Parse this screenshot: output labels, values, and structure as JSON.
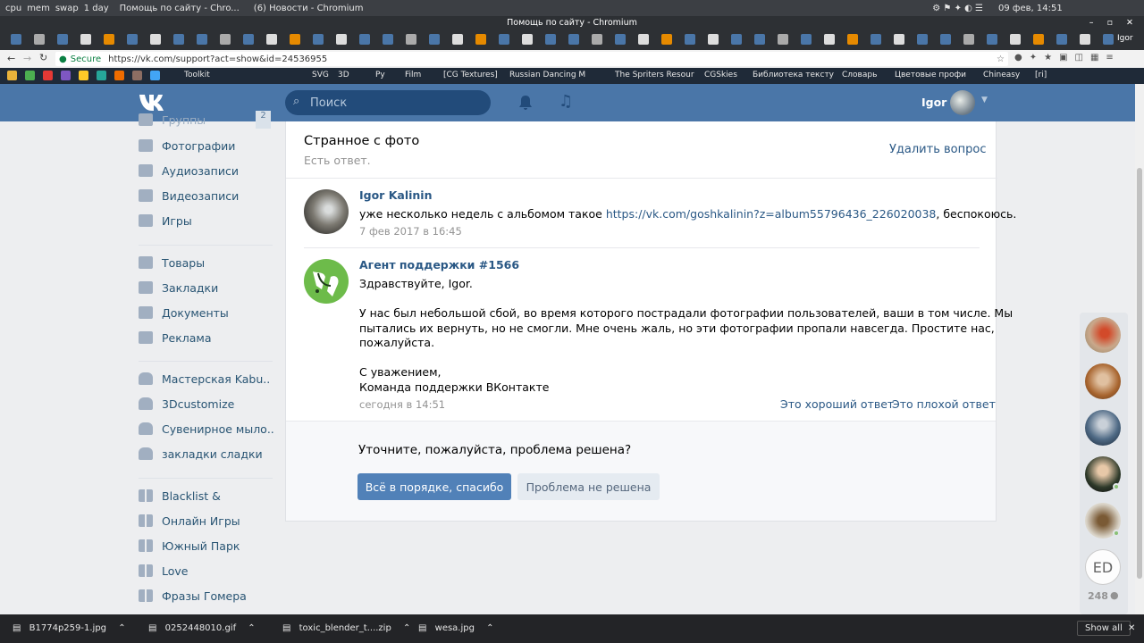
{
  "system": {
    "items": [
      "cpu",
      "mem",
      "swap",
      "1 day"
    ],
    "tab1": "Помощь по сайту - Chro...",
    "tab2": "(6) Новости - Chromium",
    "window_title": "Помощь по сайту - Chromium",
    "datetime": "09 фев, 14:51",
    "profile": "Igor"
  },
  "browser": {
    "secure": "Secure",
    "url": "https://vk.com/support?act=show&id=24536955"
  },
  "bookmarks": [
    "Toolkit",
    "SVG",
    "3D",
    "Py",
    "Film",
    "[CG Textures]",
    "Russian Dancing M",
    "The Spriters Resour",
    "CGSkies",
    "Библиотека тексту",
    "Словарь",
    "Цветовые профи",
    "Chineasy",
    "[ri]"
  ],
  "header": {
    "search_placeholder": "Поиск",
    "user_name": "Igor"
  },
  "sidebar": {
    "groups_label": "Группы",
    "groups_count": "2",
    "items": [
      "Фотографии",
      "Аудиозаписи",
      "Видеозаписи",
      "Игры",
      "Товары",
      "Закладки",
      "Документы",
      "Реклама",
      "Мастерская Kabu..",
      "3Dcustomize",
      "Сувенирное мыло..",
      "закладки сладки",
      "Blacklist &",
      "Онлайн Игры",
      "Южный Парк",
      "Love",
      "Фразы Гомера"
    ]
  },
  "question": {
    "title": "Странное с фото",
    "status": "Есть ответ.",
    "delete_label": "Удалить вопрос"
  },
  "messages": [
    {
      "author": "Igor Kalinin",
      "text_before": "уже несколько недель с альбомом такое ",
      "link": "https://vk.com/goshkalinin?z=album55796436_226020038",
      "text_after": ", беспокоюсь.",
      "date": "7 фев 2017 в 16:45"
    },
    {
      "author": "Агент поддержки #1566",
      "greeting": "Здравствуйте, Igor.",
      "line1": "У нас был небольшой сбой, во время которого пострадали фотографии пользователей, ваши в том числе. Мы",
      "line2": "пытались их вернуть, но не смогли. Мне очень жаль, но эти фотографии пропали навсегда. Простите нас,",
      "line3": "пожалуйста.",
      "sign1": "С уважением,",
      "sign2": "Команда поддержки ВКонтакте",
      "date": "сегодня в 14:51",
      "good_answer": "Это хороший ответ",
      "separator": "·",
      "bad_answer": "Это плохой ответ"
    }
  ],
  "resolve": {
    "question": "Уточните, пожалуйста, проблема решена?",
    "ok_label": "Всё в порядке, спасибо",
    "not_ok_label": "Проблема не решена"
  },
  "friends_count": "248",
  "downloads": {
    "files": [
      "B1774p259-1.jpg",
      "0252448010.gif",
      "toxic_blender_t....zip",
      "wesa.jpg"
    ],
    "show_all": "Show all"
  },
  "colors": {
    "vk_blue": "#4a76a8",
    "link": "#2a5885",
    "button": "#5181b8"
  }
}
